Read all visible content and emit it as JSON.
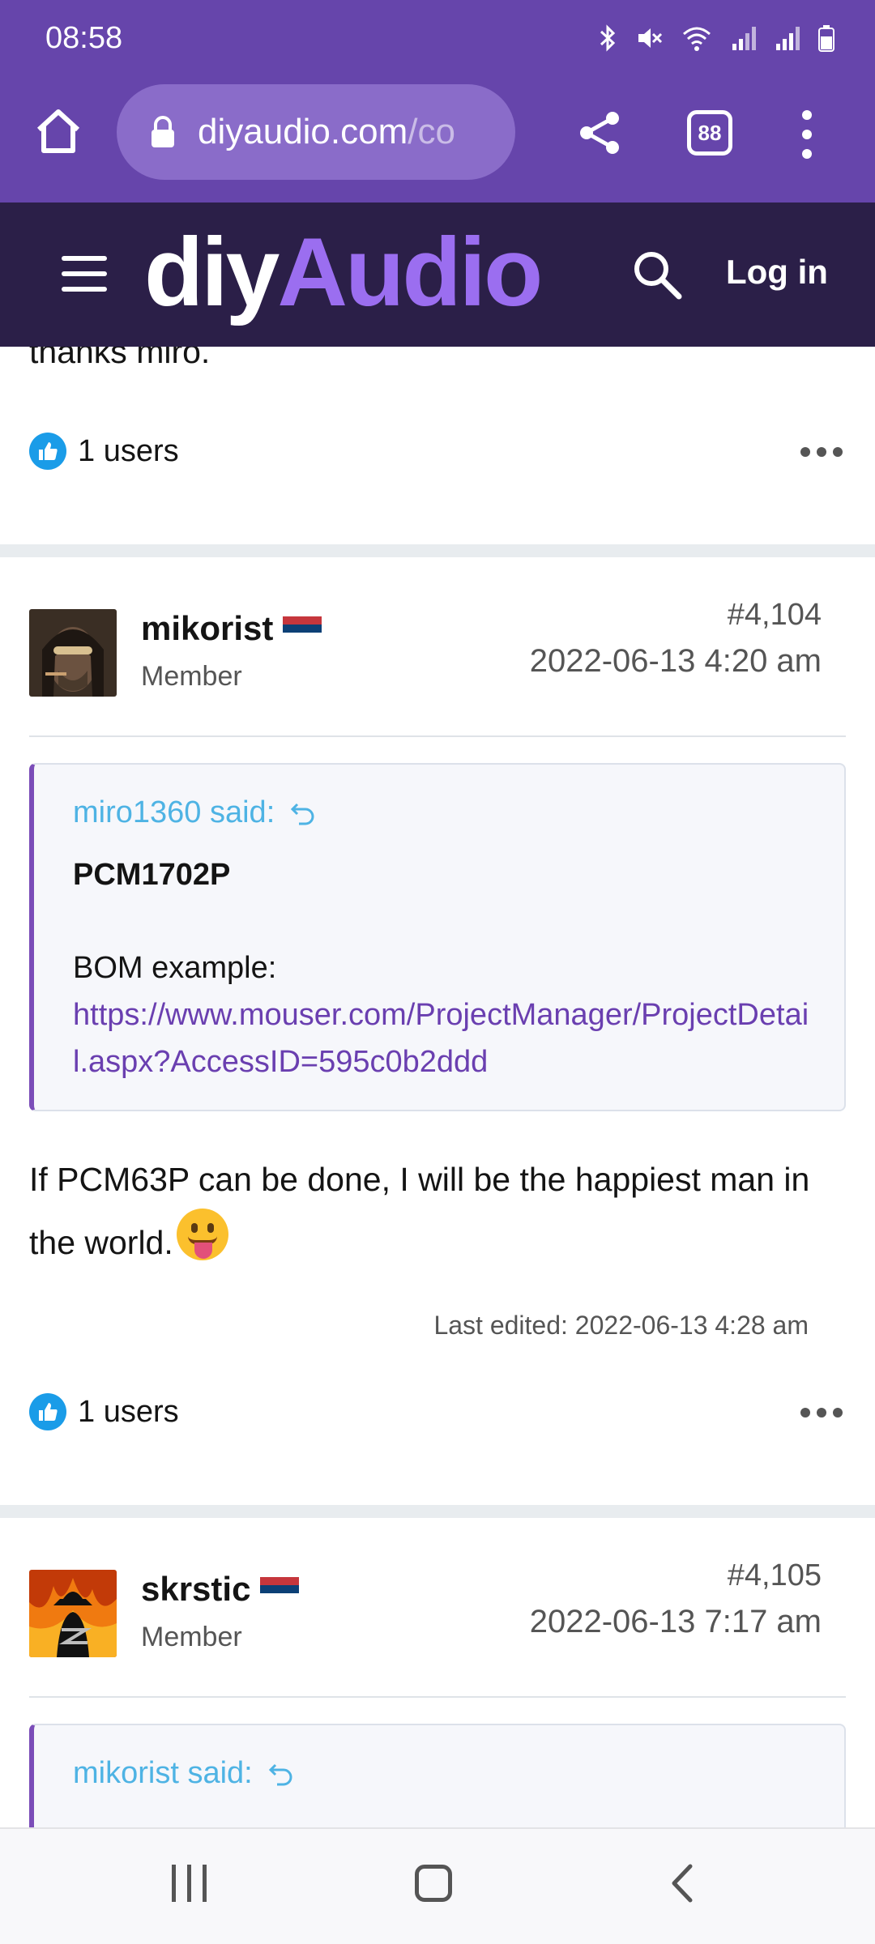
{
  "status_bar": {
    "time": "08:58"
  },
  "browser": {
    "url_main": "diyaudio.com",
    "url_dim": "/co",
    "tab_count": "88"
  },
  "site": {
    "logo_part1": "diy",
    "logo_part2": "Audio",
    "login_label": "Log in"
  },
  "prev_post": {
    "text": "thanks miro.",
    "reactions": "1 users"
  },
  "posts": [
    {
      "username": "mikorist",
      "role": "Member",
      "number": "#4,104",
      "date": "2022-06-13 4:20 am",
      "quote": {
        "author": "miro1360 said:",
        "title": "PCM1702P",
        "body": "BOM example:",
        "link": "https://www.mouser.com/ProjectManager/ProjectDetail.aspx?AccessID=595c0b2ddd"
      },
      "body": "If PCM63P can be done, I will be the happiest man in the world.",
      "last_edited": "Last edited: 2022-06-13 4:28 am",
      "reactions": "1 users"
    },
    {
      "username": "skrstic",
      "role": "Member",
      "number": "#4,105",
      "date": "2022-06-13 7:17 am",
      "quote": {
        "author": "mikorist said:"
      }
    }
  ],
  "colors": {
    "browser_bar": "#6645ab",
    "site_header": "#2b1f48",
    "logo_accent": "#9b6ef0",
    "quote_author": "#4eb3e4",
    "link": "#6a3fb0"
  }
}
